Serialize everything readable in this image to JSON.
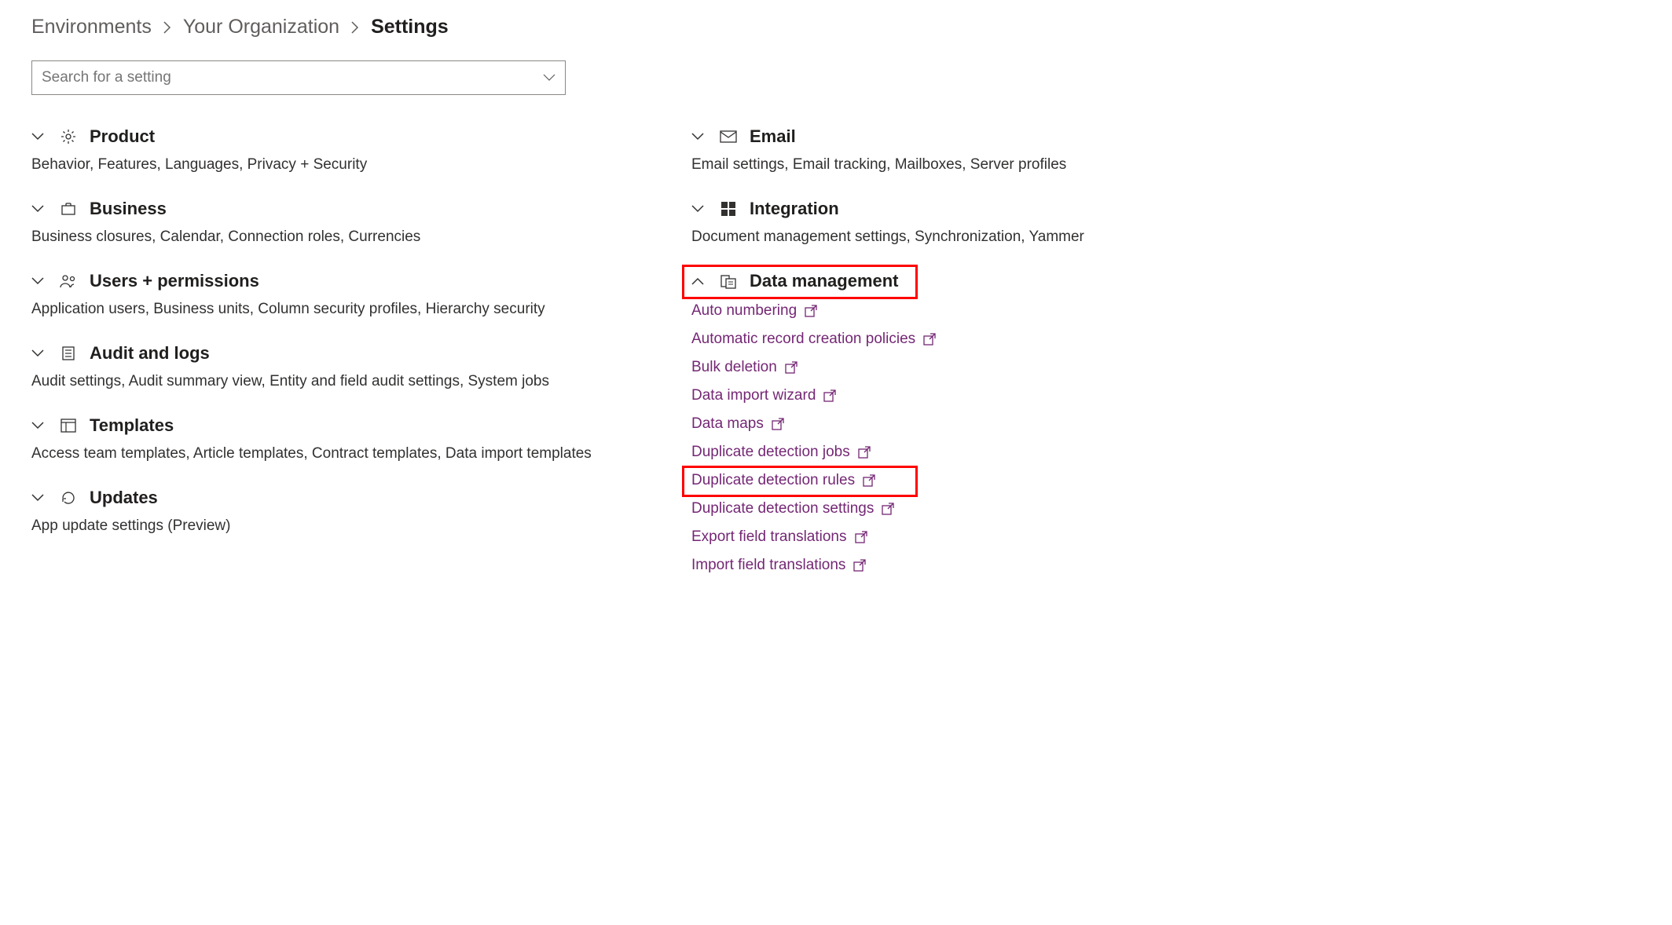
{
  "breadcrumb": {
    "items": [
      "Environments",
      "Your Organization"
    ],
    "current": "Settings"
  },
  "search": {
    "placeholder": "Search for a setting"
  },
  "left_sections": [
    {
      "key": "product",
      "title": "Product",
      "desc": "Behavior, Features, Languages, Privacy + Security",
      "expanded": false
    },
    {
      "key": "business",
      "title": "Business",
      "desc": "Business closures, Calendar, Connection roles, Currencies",
      "expanded": false
    },
    {
      "key": "users",
      "title": "Users + permissions",
      "desc": "Application users, Business units, Column security profiles, Hierarchy security",
      "expanded": false
    },
    {
      "key": "audit",
      "title": "Audit and logs",
      "desc": "Audit settings, Audit summary view, Entity and field audit settings, System jobs",
      "expanded": false
    },
    {
      "key": "templates",
      "title": "Templates",
      "desc": "Access team templates, Article templates, Contract templates, Data import templates",
      "expanded": false
    },
    {
      "key": "updates",
      "title": "Updates",
      "desc": "App update settings (Preview)",
      "expanded": false
    }
  ],
  "right_sections": [
    {
      "key": "email",
      "title": "Email",
      "desc": "Email settings, Email tracking, Mailboxes, Server profiles",
      "expanded": false
    },
    {
      "key": "integration",
      "title": "Integration",
      "desc": "Document management settings, Synchronization, Yammer",
      "expanded": false
    },
    {
      "key": "datamgmt",
      "title": "Data management",
      "expanded": true,
      "highlighted": true,
      "links": [
        {
          "label": "Auto numbering"
        },
        {
          "label": "Automatic record creation policies"
        },
        {
          "label": "Bulk deletion"
        },
        {
          "label": "Data import wizard"
        },
        {
          "label": "Data maps"
        },
        {
          "label": "Duplicate detection jobs"
        },
        {
          "label": "Duplicate detection rules",
          "highlighted": true
        },
        {
          "label": "Duplicate detection settings"
        },
        {
          "label": "Export field translations"
        },
        {
          "label": "Import field translations"
        }
      ]
    }
  ]
}
